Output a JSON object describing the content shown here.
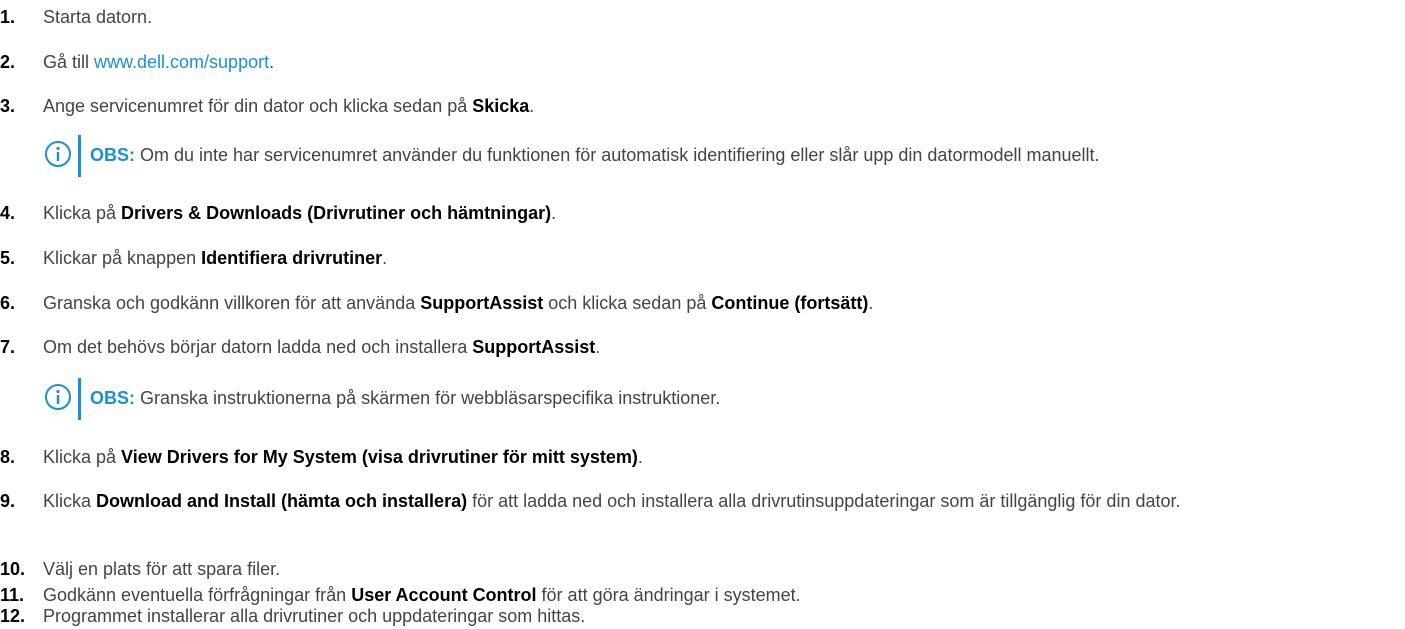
{
  "steps": [
    {
      "num": "1.",
      "parts": [
        "Starta datorn."
      ]
    },
    {
      "num": "2.",
      "parts": [
        "Gå till ",
        "www.dell.com/support",
        "."
      ]
    },
    {
      "num": "3.",
      "parts": [
        "Ange servicenumret för din dator och klicka sedan på ",
        "Skicka",
        "."
      ]
    },
    {
      "num": "4.",
      "parts": [
        "Klicka på ",
        "Drivers & Downloads (Drivrutiner och hämtningar)",
        "."
      ]
    },
    {
      "num": "5.",
      "parts": [
        "Klickar på knappen ",
        "Identifiera drivrutiner",
        "."
      ]
    },
    {
      "num": "6.",
      "parts": [
        "Granska och godkänn villkoren för att använda ",
        "SupportAssist",
        " och klicka sedan på ",
        "Continue (fortsätt)",
        "."
      ]
    },
    {
      "num": "7.",
      "parts": [
        "Om det behövs börjar datorn ladda ned och installera ",
        "SupportAssist",
        "."
      ]
    },
    {
      "num": "8.",
      "parts": [
        "Klicka på ",
        "View Drivers for My System (visa drivrutiner för mitt system)",
        "."
      ]
    },
    {
      "num": "9.",
      "parts": [
        "Klicka ",
        "Download and Install (hämta och installera)",
        " för att ladda ned och installera alla drivrutinsuppdateringar som är tillgänglig för din dator."
      ]
    },
    {
      "num": "10.",
      "parts": [
        "Välj en plats för att spara filer."
      ]
    },
    {
      "num": "11.",
      "parts": [
        "Godkänn eventuella förfrågningar från ",
        "User Account Control",
        " för att göra ändringar i systemet."
      ]
    },
    {
      "num": "12.",
      "parts": [
        "Programmet installerar alla drivrutiner och uppdateringar som hittas."
      ]
    }
  ],
  "notes": [
    {
      "label": "OBS:",
      "text": " Om du inte har servicenumret använder du funktionen för automatisk identifiering eller slår upp din datormodell manuellt."
    },
    {
      "label": "OBS:",
      "text": " Granska instruktionerna på skärmen för webbläsarspecifika instruktioner."
    }
  ],
  "icons": {
    "note": "info-icon"
  },
  "colors": {
    "link": "#1a8fd6",
    "accent": "#1a8fd6",
    "text": "#444444",
    "bold": "#000000"
  }
}
